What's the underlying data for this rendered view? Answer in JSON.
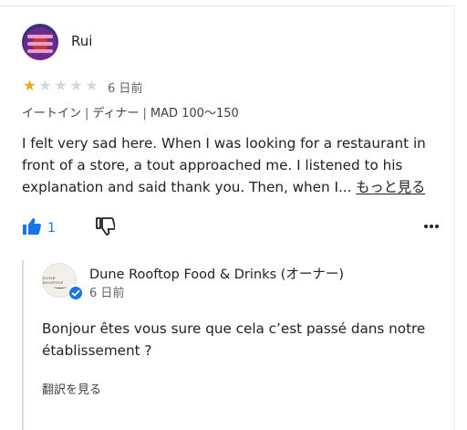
{
  "review": {
    "user_name": "Rui",
    "rating": 1,
    "rating_max": 5,
    "date": "6 日前",
    "meta": {
      "dining": "イートイン",
      "meal": "ディナー",
      "price": "MAD 100～150"
    },
    "text": "I felt very sad here. When I was looking for a restaurant in front of a store, a tout approached me. I listened to his explanation and said thank you. Then, when I...",
    "more_link": "もっと見る",
    "likes": "1"
  },
  "owner_reply": {
    "name": "Dune Rooftop Food & Drinks (オーナー)",
    "date": "6 日前",
    "text": "Bonjour êtes vous sure que cela c’est passé dans notre établissement ?",
    "translate_link": "翻訳を見る",
    "logo_text": "DUNE ROOFTOP"
  },
  "colors": {
    "star_on": "#f4a51c",
    "star_off": "#d6d6d6",
    "accent": "#1a73e8"
  },
  "icons": {
    "like": "thumbs-up-icon",
    "dislike": "thumbs-down-icon",
    "more": "more-horizontal-icon",
    "verified": "verified-check-icon"
  }
}
